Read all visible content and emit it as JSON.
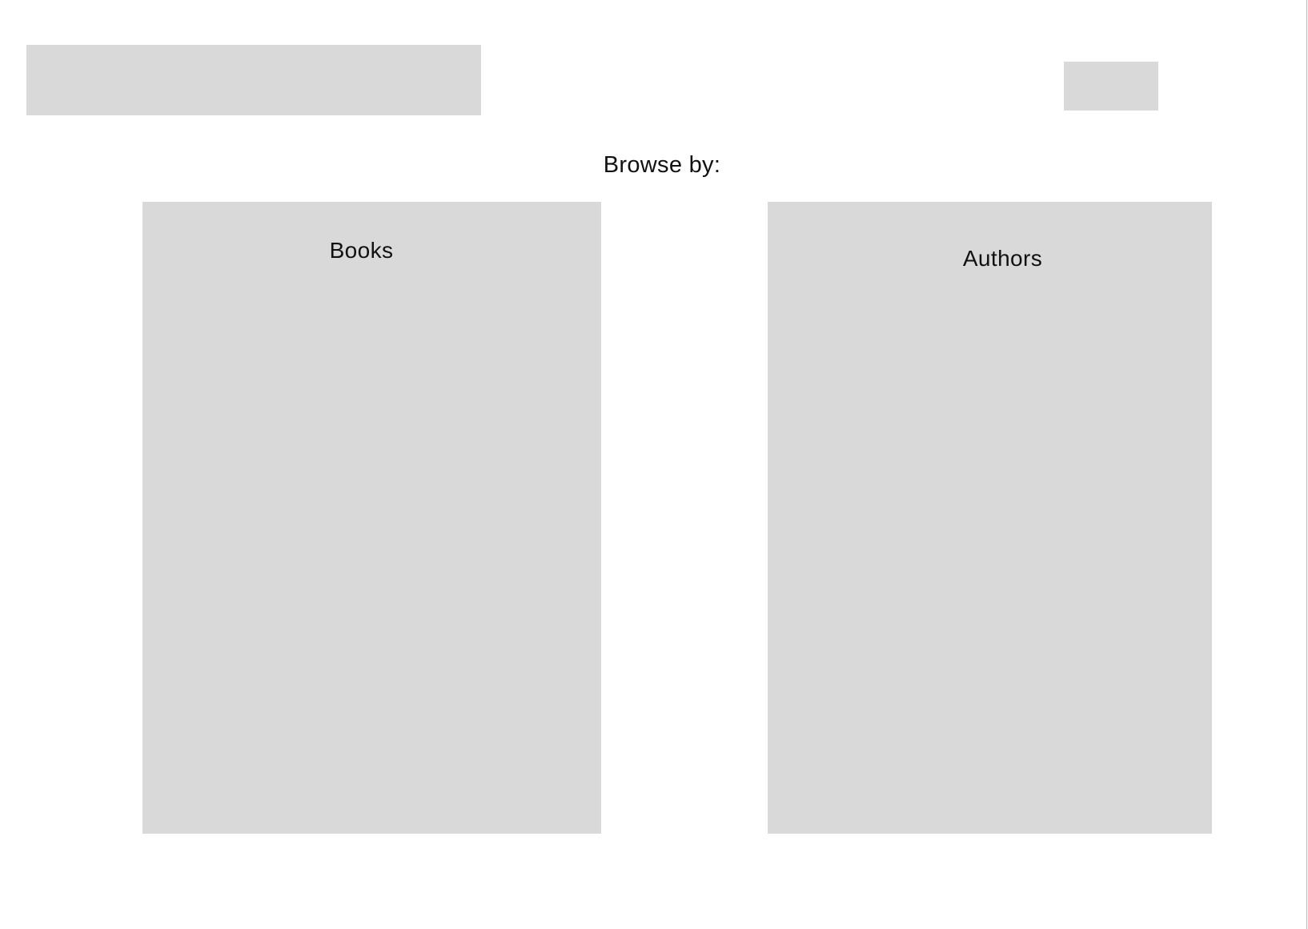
{
  "header": {
    "logo_placeholder": "",
    "action_placeholder": ""
  },
  "main": {
    "browse_label": "Browse by:",
    "cards": [
      {
        "label": "Books"
      },
      {
        "label": "Authors"
      }
    ]
  }
}
